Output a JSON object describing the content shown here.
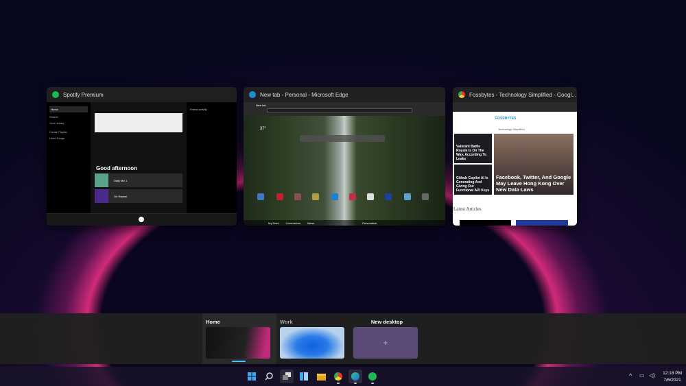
{
  "windows": [
    {
      "title": "Spotify Premium",
      "icon": "spotify-icon",
      "accent": "#1db954",
      "content": {
        "nav": [
          "Home",
          "Search",
          "Your Library"
        ],
        "actions": [
          "Create Playlist",
          "Liked Songs"
        ],
        "greeting": "Good afternoon",
        "mixes": [
          "Daily Mix 1",
          "On Repeat"
        ],
        "friends_title": "Friend activity"
      }
    },
    {
      "title": "New tab - Personal - Microsoft Edge",
      "icon": "edge-icon",
      "accent": "#1e90d0",
      "content": {
        "tab": "New tab",
        "weather": "37°",
        "nav": [
          "My Feed",
          "Coronavirus",
          "News"
        ],
        "personalize": "Personalize"
      }
    },
    {
      "title": "Fossbytes - Technology Simplified - Googl...",
      "icon": "chrome-icon",
      "accent": "#e8b025",
      "content": {
        "logo": "FOSSBYTES",
        "tagline": "Technology Simplified",
        "articles": [
          "Valorant Battle Royale Is On The Way, According To Leaks",
          "Github Copilot AI Is Generating And Giving Out Functional API Keys",
          "Facebook, Twitter, And Google May Leave Hong Kong Over New Data Laws"
        ],
        "section": "Latest Articles"
      }
    }
  ],
  "desktops": [
    {
      "label": "Home",
      "active": true
    },
    {
      "label": "Work",
      "active": false
    },
    {
      "label": "New desktop",
      "active": false,
      "icon": "plus-icon"
    }
  ],
  "taskbar": {
    "icons": [
      "windows-start-icon",
      "search-icon",
      "task-view-icon",
      "widgets-icon",
      "file-explorer-icon",
      "chrome-icon",
      "edge-icon",
      "spotify-icon"
    ],
    "clock": {
      "time": "12:18 PM",
      "date": "7/6/2021"
    }
  }
}
